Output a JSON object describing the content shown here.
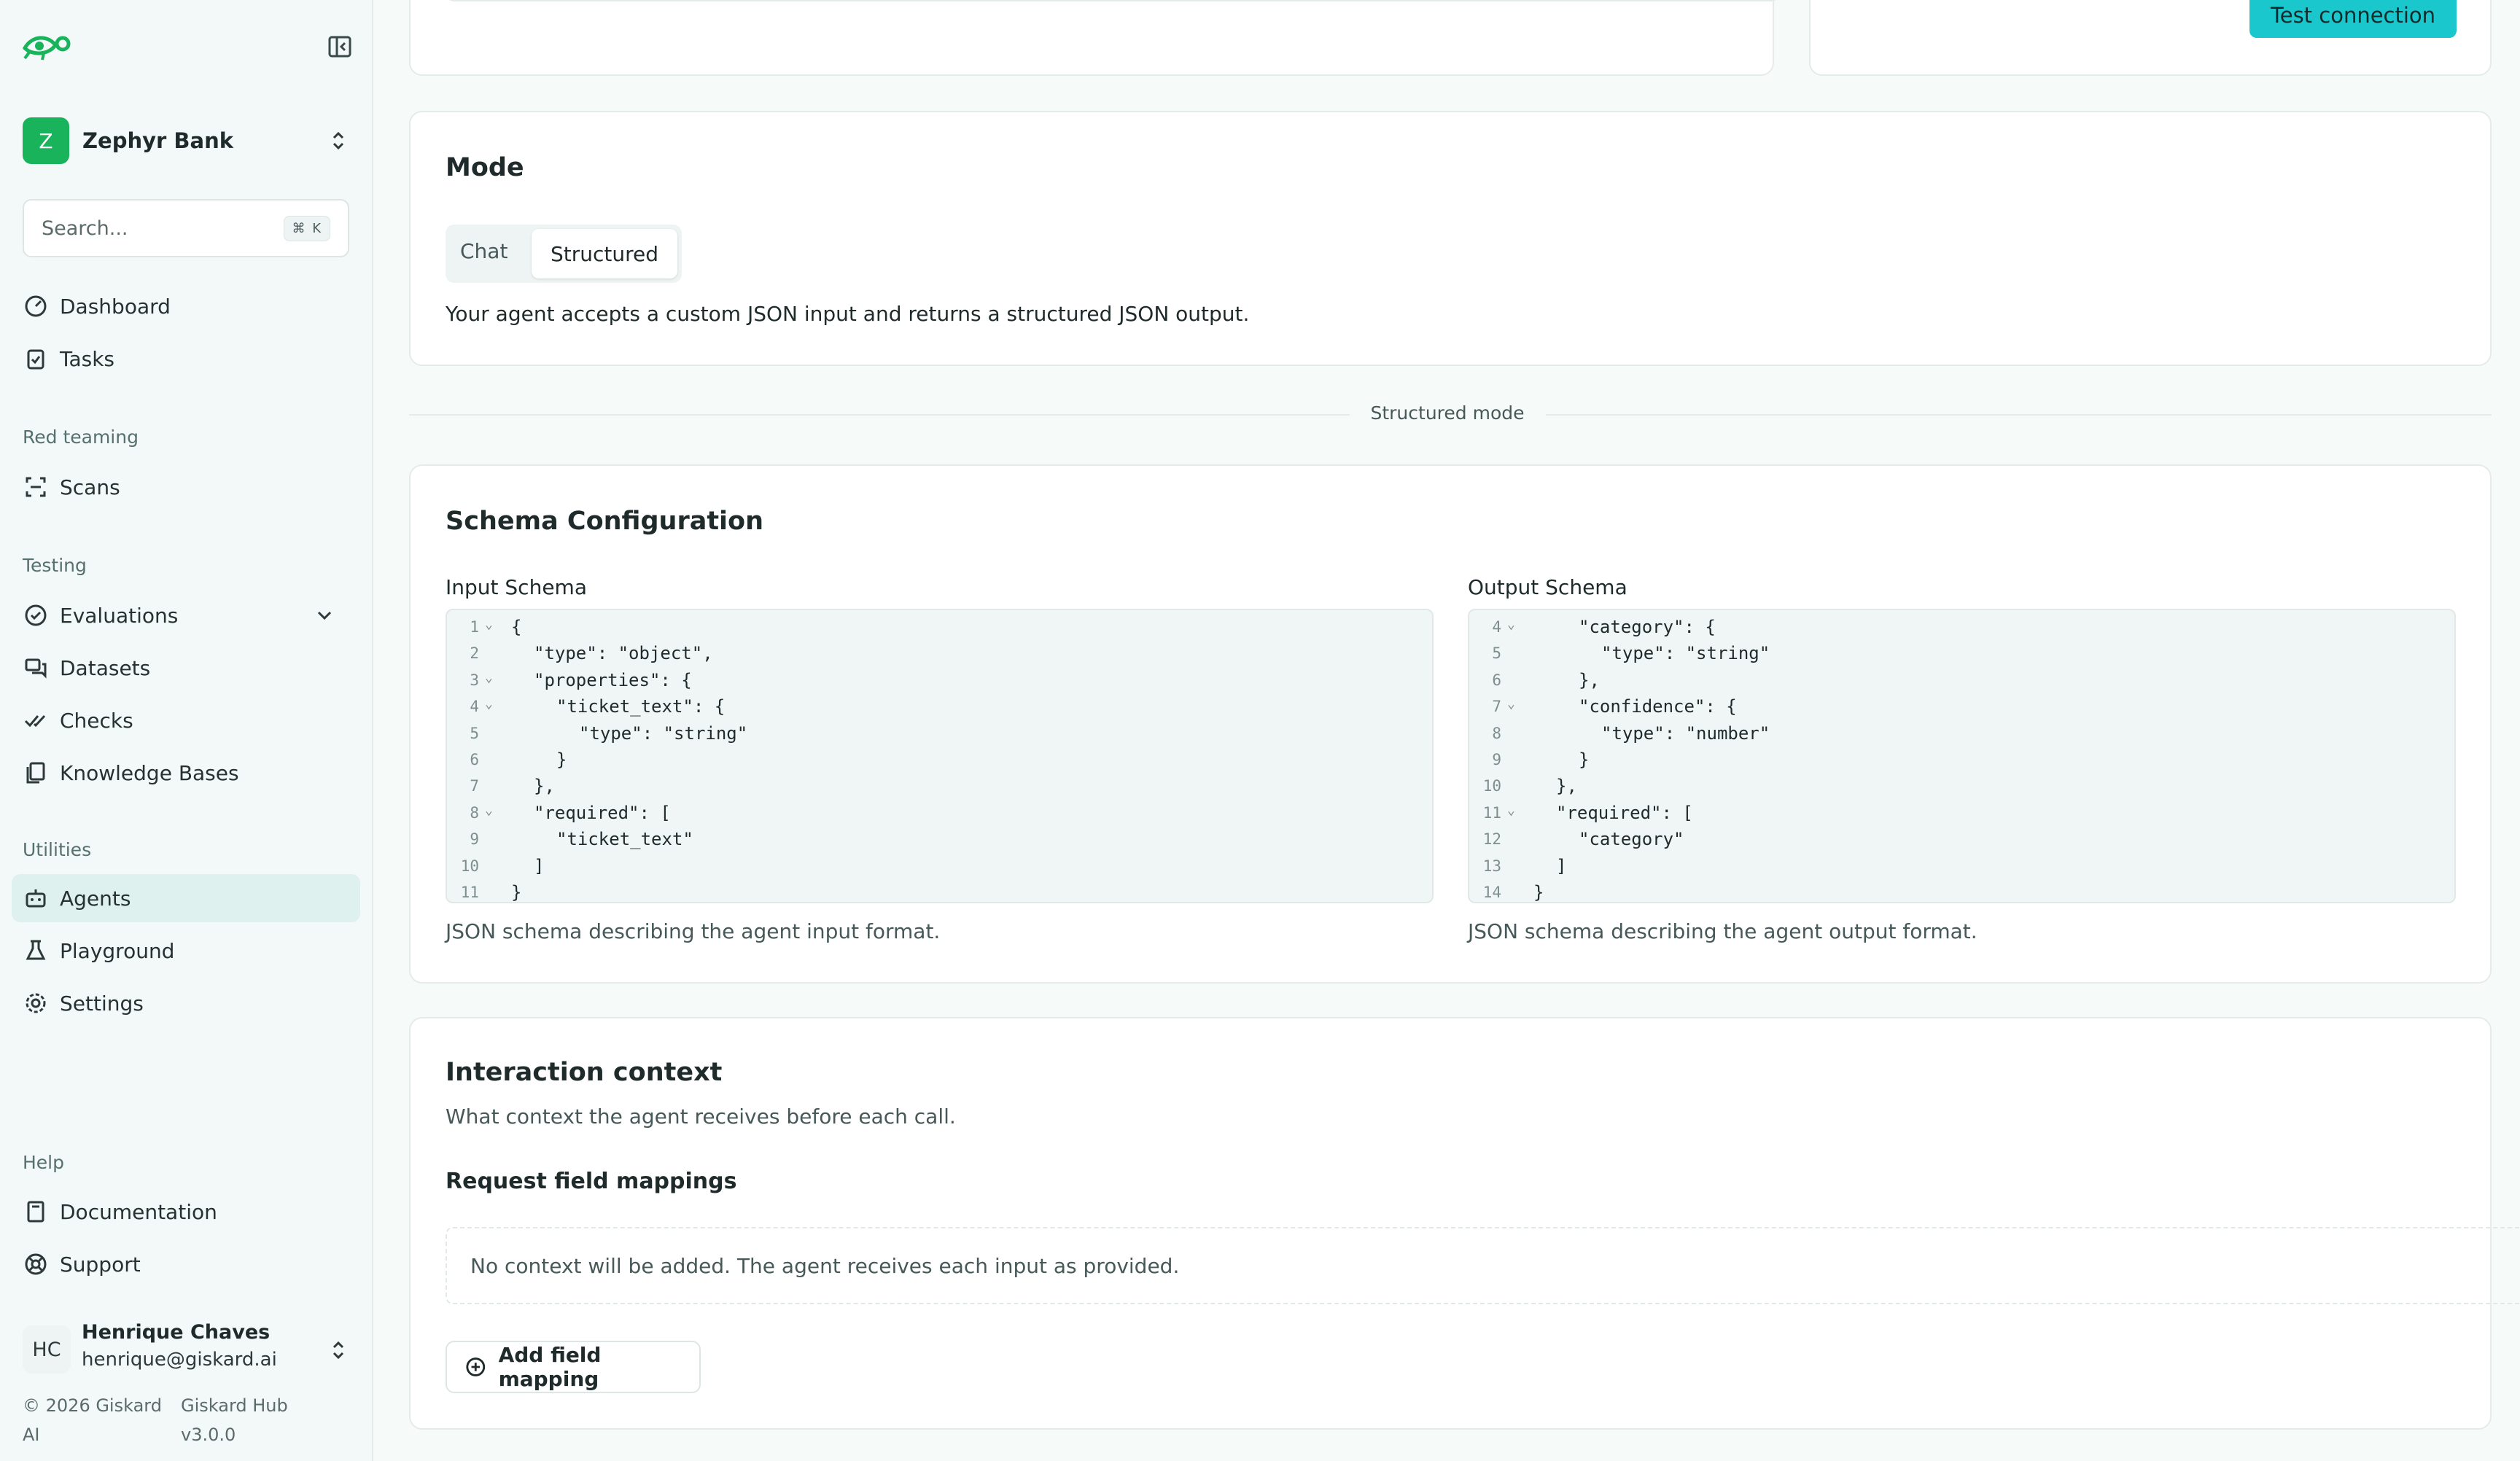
{
  "sidebar": {
    "org": {
      "initial": "Z",
      "name": "Zephyr Bank"
    },
    "search": {
      "placeholder": "Search...",
      "shortcut": "⌘ K"
    },
    "nav": {
      "dashboard": "Dashboard",
      "tasks": "Tasks",
      "red_teaming_label": "Red teaming",
      "scans": "Scans",
      "testing_label": "Testing",
      "evaluations": "Evaluations",
      "datasets": "Datasets",
      "checks": "Checks",
      "knowledge_bases": "Knowledge Bases",
      "utilities_label": "Utilities",
      "agents": "Agents",
      "playground": "Playground",
      "settings": "Settings",
      "help_label": "Help",
      "documentation": "Documentation",
      "support": "Support"
    },
    "user": {
      "initials": "HC",
      "name": "Henrique Chaves",
      "email": "henrique@giskard.ai"
    },
    "footer": {
      "copyright_1": "© 2026 Giskard",
      "copyright_2": "AI",
      "version_1": "Giskard Hub",
      "version_2": "v3.0.0"
    }
  },
  "top": {
    "test_connection": "Test connection"
  },
  "mode": {
    "title": "Mode",
    "options": [
      "Chat",
      "Structured"
    ],
    "selected": "Structured",
    "description": "Your agent accepts a custom JSON input and returns a structured JSON output."
  },
  "divider_label": "Structured mode",
  "schema": {
    "title": "Schema Configuration",
    "input": {
      "label": "Input Schema",
      "help": "JSON schema describing the agent input format.",
      "lines": [
        {
          "n": "1",
          "fold": true,
          "indent": 0,
          "text": "{"
        },
        {
          "n": "2",
          "fold": false,
          "indent": 1,
          "text": "\"type\": \"object\","
        },
        {
          "n": "3",
          "fold": true,
          "indent": 1,
          "text": "\"properties\": {"
        },
        {
          "n": "4",
          "fold": true,
          "indent": 2,
          "text": "\"ticket_text\": {"
        },
        {
          "n": "5",
          "fold": false,
          "indent": 3,
          "text": "\"type\": \"string\""
        },
        {
          "n": "6",
          "fold": false,
          "indent": 2,
          "text": "}"
        },
        {
          "n": "7",
          "fold": false,
          "indent": 1,
          "text": "},"
        },
        {
          "n": "8",
          "fold": true,
          "indent": 1,
          "text": "\"required\": ["
        },
        {
          "n": "9",
          "fold": false,
          "indent": 2,
          "text": "\"ticket_text\""
        },
        {
          "n": "10",
          "fold": false,
          "indent": 1,
          "text": "]"
        },
        {
          "n": "11",
          "fold": false,
          "indent": 0,
          "text": "}"
        }
      ]
    },
    "output": {
      "label": "Output Schema",
      "help": "JSON schema describing the agent output format.",
      "lines": [
        {
          "n": "4",
          "fold": true,
          "indent": 2,
          "text": "\"category\": {"
        },
        {
          "n": "5",
          "fold": false,
          "indent": 3,
          "text": "\"type\": \"string\""
        },
        {
          "n": "6",
          "fold": false,
          "indent": 2,
          "text": "},"
        },
        {
          "n": "7",
          "fold": true,
          "indent": 2,
          "text": "\"confidence\": {"
        },
        {
          "n": "8",
          "fold": false,
          "indent": 3,
          "text": "\"type\": \"number\""
        },
        {
          "n": "9",
          "fold": false,
          "indent": 2,
          "text": "}"
        },
        {
          "n": "10",
          "fold": false,
          "indent": 1,
          "text": "},"
        },
        {
          "n": "11",
          "fold": true,
          "indent": 1,
          "text": "\"required\": ["
        },
        {
          "n": "12",
          "fold": false,
          "indent": 2,
          "text": "\"category\""
        },
        {
          "n": "13",
          "fold": false,
          "indent": 1,
          "text": "]"
        },
        {
          "n": "14",
          "fold": false,
          "indent": 0,
          "text": "}"
        }
      ]
    }
  },
  "interaction": {
    "title": "Interaction context",
    "subtitle": "What context the agent receives before each call.",
    "mappings_title": "Request field mappings",
    "empty_text": "No context will be added. The agent receives each input as provided.",
    "add_button": "Add field mapping"
  },
  "colors": {
    "accent": "#19c7cc",
    "org": "#18b35a",
    "active_nav": "#dff1ef"
  }
}
